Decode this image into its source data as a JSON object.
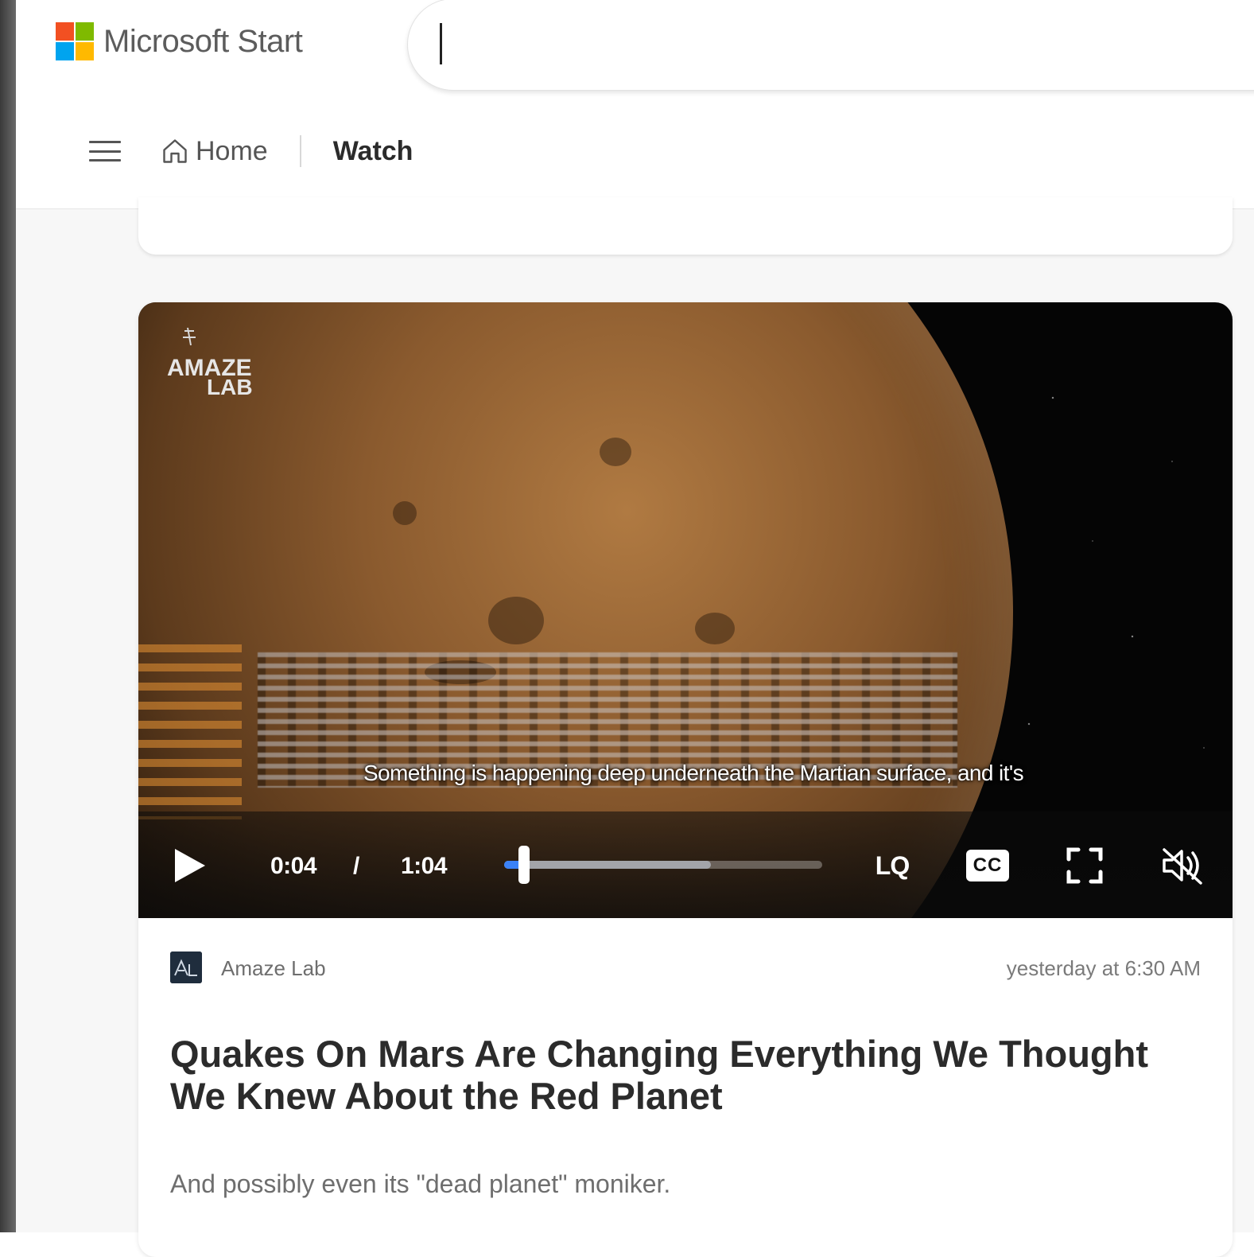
{
  "header": {
    "brand": "Microsoft Start",
    "logo_colors": [
      "#f25022",
      "#7fba00",
      "#00a4ef",
      "#ffb900"
    ],
    "search": {
      "value": "",
      "placeholder": ""
    }
  },
  "nav": {
    "menu_icon": "hamburger-menu-icon",
    "home_icon": "home-icon",
    "home_label": "Home",
    "watch_label": "Watch"
  },
  "video": {
    "channel_watermark_line1": "AMAZE",
    "channel_watermark_line2": "LAB",
    "caption": "Something is happening deep underneath the Martian surface, and it's",
    "current_time": "0:04",
    "time_separator": "/",
    "duration": "1:04",
    "progress_fraction": 0.0625,
    "buffered_fraction": 0.65,
    "quality_label": "LQ",
    "cc_label": "CC",
    "accent_color": "#3b82f6",
    "icons": {
      "play": "play-icon",
      "fullscreen": "fullscreen-icon",
      "mute": "muted-speaker-icon"
    }
  },
  "article": {
    "source": "Amaze Lab",
    "timestamp": "yesterday at 6:30 AM",
    "title": "Quakes On Mars Are Changing Everything We Thought We Knew About the Red Planet",
    "abstract": "And possibly even its \"dead planet\" moniker."
  }
}
